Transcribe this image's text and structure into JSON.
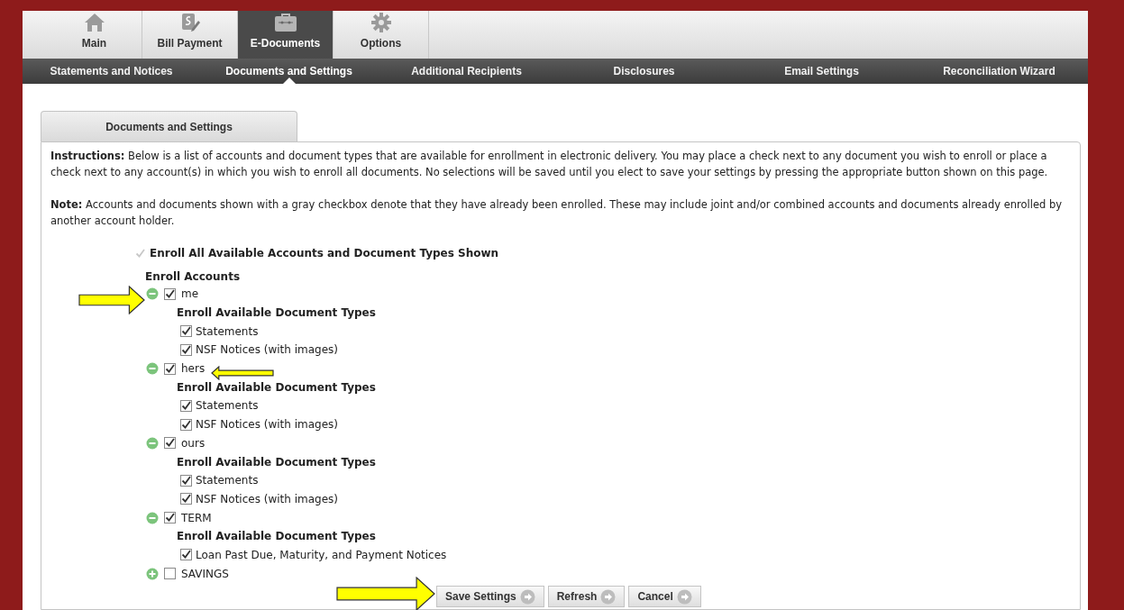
{
  "main_tabs": [
    {
      "label": "Main",
      "kind": "home",
      "selected": false
    },
    {
      "label": "Bill Payment",
      "kind": "bill",
      "selected": false
    },
    {
      "label": "E-Documents",
      "kind": "briefcase",
      "selected": true
    },
    {
      "label": "Options",
      "kind": "gear",
      "selected": false
    }
  ],
  "sub_nav": [
    {
      "label": "Statements and Notices",
      "selected": false
    },
    {
      "label": "Documents and Settings",
      "selected": true
    },
    {
      "label": "Additional Recipients",
      "selected": false
    },
    {
      "label": "Disclosures",
      "selected": false
    },
    {
      "label": "Email Settings",
      "selected": false
    },
    {
      "label": "Reconciliation Wizard",
      "selected": false
    }
  ],
  "section_tab": "Documents and Settings",
  "instructions": "**Instructions:** Below is a list of accounts and document types that are available for enrollment in electronic delivery. You may place a check next to any document you wish to enroll or place a check next to any account(s) in which you wish to enroll all documents. No selections will be saved until you elect to save your settings by pressing the appropriate button shown on this page.",
  "note": "**Note:** Accounts and documents shown with a gray checkbox denote that they have already been enrolled. These may include joint and/or combined accounts and documents already enrolled by another account holder.",
  "enroll_all": {
    "label": "Enroll All Available Accounts and Document Types Shown",
    "checked": true,
    "disabled": true
  },
  "accounts_heading": "Enroll Accounts",
  "accounts": [
    {
      "name": "me",
      "checked": true,
      "expanded": true,
      "documents_heading": "Enroll Available Document Types",
      "documents": [
        {
          "label": "Statements",
          "checked": true
        },
        {
          "label": "NSF Notices (with images)",
          "checked": true
        }
      ]
    },
    {
      "name": "hers",
      "checked": true,
      "expanded": true,
      "documents_heading": "Enroll Available Document Types",
      "documents": [
        {
          "label": "Statements",
          "checked": true
        },
        {
          "label": "NSF Notices (with images)",
          "checked": true
        }
      ]
    },
    {
      "name": "ours",
      "checked": true,
      "expanded": true,
      "documents_heading": "Enroll Available Document Types",
      "documents": [
        {
          "label": "Statements",
          "checked": true
        },
        {
          "label": "NSF Notices (with images)",
          "checked": true
        }
      ]
    },
    {
      "name": "TERM",
      "checked": true,
      "expanded": true,
      "documents_heading": "Enroll Available Document Types",
      "documents": [
        {
          "label": "Loan Past Due, Maturity, and Payment Notices",
          "checked": true
        }
      ]
    },
    {
      "name": "SAVINGS",
      "checked": false,
      "expanded": false
    }
  ],
  "buttons": [
    "Save Settings",
    "Refresh",
    "Cancel"
  ]
}
